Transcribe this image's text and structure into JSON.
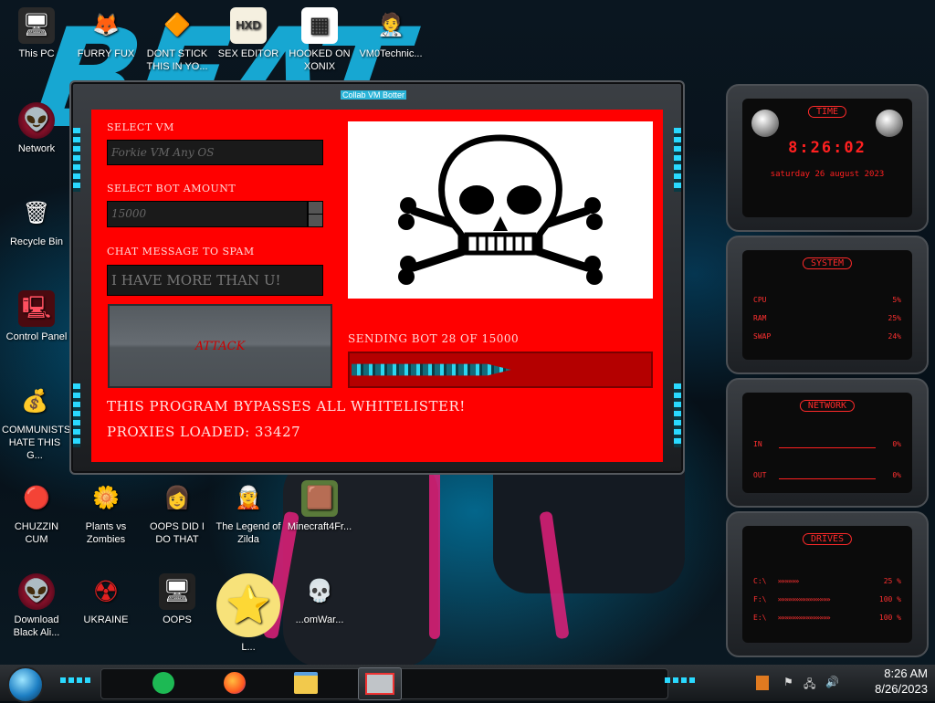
{
  "desktop": {
    "wallpaper_text": "BEAT",
    "icons": [
      {
        "label": "This PC",
        "glyph": "🖥"
      },
      {
        "label": "FURRY FUX",
        "glyph": "🦊"
      },
      {
        "label": "DONT STICK THIS IN YO...",
        "glyph": "🔶"
      },
      {
        "label": "SEX EDITOR",
        "glyph": "HXD"
      },
      {
        "label": "HOOKED ON XONIX",
        "glyph": "▦"
      },
      {
        "label": "VM0Technic...",
        "glyph": "🧑‍⚕️"
      },
      {
        "label": "Network",
        "glyph": "👽"
      },
      {
        "label": "Recycle Bin",
        "glyph": "🗑"
      },
      {
        "label": "Control Panel",
        "glyph": "🖳"
      },
      {
        "label": "COMMUNISTS HATE THIS G...",
        "glyph": "💰"
      },
      {
        "label": "CHUZZIN CUM",
        "glyph": "🔴"
      },
      {
        "label": "Plants vs Zombies",
        "glyph": "🌼"
      },
      {
        "label": "OOPS DID I DO THAT",
        "glyph": "👩"
      },
      {
        "label": "The Legend of Zilda",
        "glyph": "🧝"
      },
      {
        "label": "Minecraft4Fr...",
        "glyph": "🟫"
      },
      {
        "label": "Download Black Ali...",
        "glyph": "👽"
      },
      {
        "label": "UKRAINE",
        "glyph": "☢"
      },
      {
        "label": "OOPS",
        "glyph": "🖥"
      },
      {
        "label": "L...",
        "glyph": "⭐"
      },
      {
        "label": "...omWar...",
        "glyph": "💀"
      }
    ]
  },
  "bot_window": {
    "title": "Collab VM Botter",
    "select_vm_label": "SELECT VM",
    "select_vm_value": "Forkie VM Any OS",
    "bot_amount_label": "SELECT BOT AMOUNT",
    "bot_amount_value": "15000",
    "chat_label": "CHAT MESSAGE TO SPAM",
    "chat_value": "I HAVE MORE THAN U!",
    "attack_label": "ATTACK",
    "sending_status": "SENDING BOT 28 OF 15000",
    "progress_fraction": 0.53,
    "bypass_text": "THIS PROGRAM BYPASSES ALL WHITELISTER!",
    "proxies_text": "PROXIES LOADED: 33427",
    "skull_icon": "skull-and-crossbones-icon"
  },
  "widgets": {
    "time": {
      "title": "TIME",
      "clock": "8:26:02",
      "date": "saturday 26 august 2023"
    },
    "system": {
      "title": "SYSTEM",
      "rows": [
        {
          "label": "CPU",
          "value": "5%"
        },
        {
          "label": "RAM",
          "value": "25%"
        },
        {
          "label": "SWAP",
          "value": "24%"
        }
      ]
    },
    "network": {
      "title": "NETWORK",
      "rows": [
        {
          "label": "IN",
          "value": "0%"
        },
        {
          "label": "OUT",
          "value": "0%"
        }
      ]
    },
    "drives": {
      "title": "DRIVES",
      "rows": [
        {
          "label": "C:\\",
          "value": "25 %"
        },
        {
          "label": "F:\\",
          "value": "100 %"
        },
        {
          "label": "E:\\",
          "value": "100 %"
        }
      ]
    }
  },
  "taskbar": {
    "time": "8:26 AM",
    "date": "8/26/2023",
    "apps": [
      "spotify-icon",
      "firefox-icon",
      "file-explorer-icon",
      "collab-vm-botter-icon"
    ]
  },
  "colors": {
    "panel_red": "#ff0000",
    "widget_red": "#ff2020",
    "accent_cyan": "#2ad9ff"
  }
}
